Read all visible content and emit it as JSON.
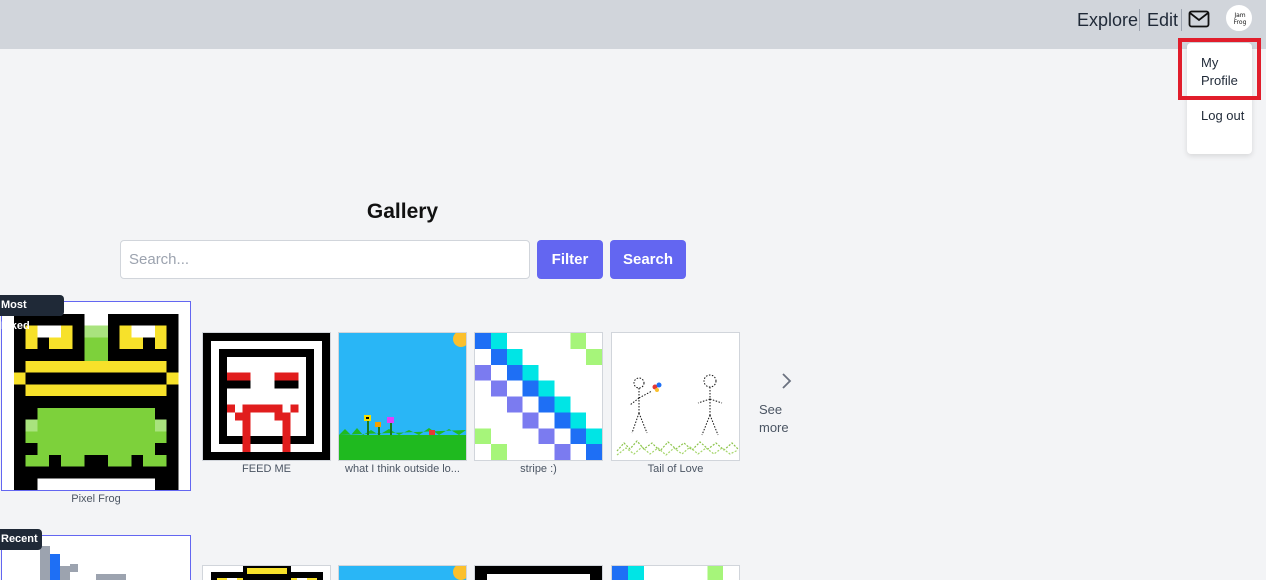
{
  "nav": {
    "explore": "Explore",
    "edit": "Edit",
    "mail_icon": "mail-icon",
    "avatar_icon": "user-avatar-icon"
  },
  "dropdown": {
    "profile": "My Profile",
    "logout": "Log out"
  },
  "gallery": {
    "title": "Gallery",
    "search_placeholder": "Search...",
    "filter_label": "Filter",
    "search_label": "Search"
  },
  "most_liked": {
    "tag": "Most Liked",
    "featured_caption": "Pixel Frog",
    "items": [
      {
        "caption": "FEED ME"
      },
      {
        "caption": "what I think outside lo..."
      },
      {
        "caption": "stripe :)"
      },
      {
        "caption": "Tail of Love"
      }
    ],
    "see_more": "See more"
  },
  "recent": {
    "tag": "Recent"
  },
  "colors": {
    "accent": "#6366f1",
    "topbar": "#d1d5db",
    "highlight": "#e11d2b",
    "tag_bg": "#1f2937"
  }
}
